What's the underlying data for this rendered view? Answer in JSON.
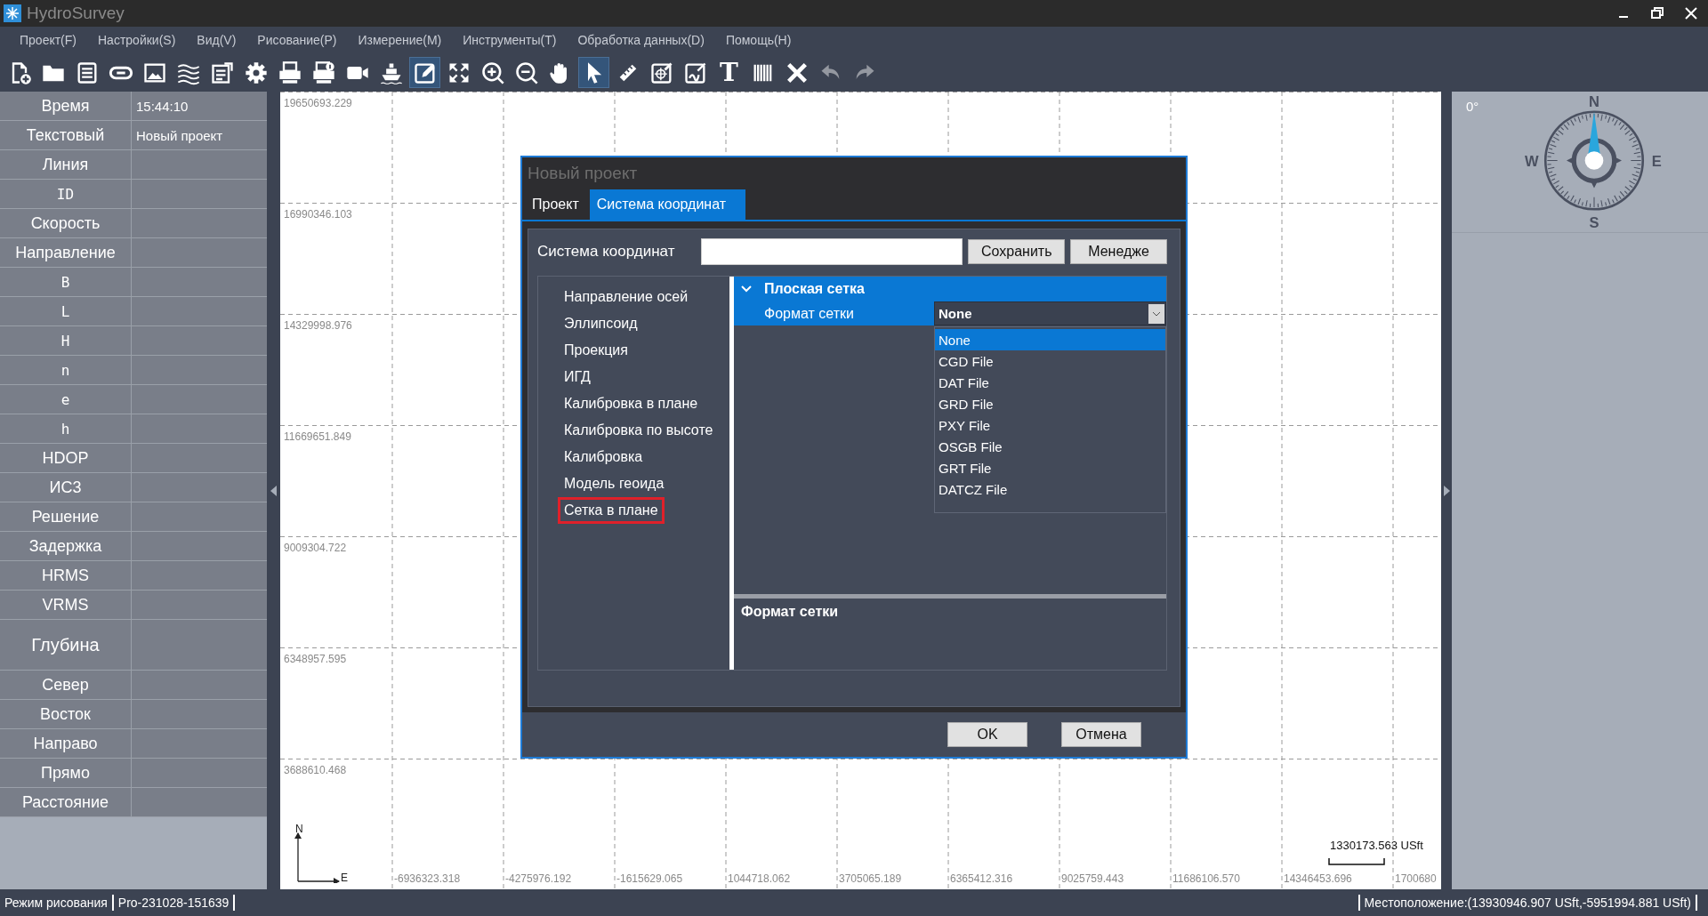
{
  "window": {
    "title": "HydroSurvey"
  },
  "menu": [
    "Проект(F)",
    "Настройки(S)",
    "Вид(V)",
    "Рисование(P)",
    "Измерение(M)",
    "Инструменты(T)",
    "Обработка данных(D)",
    "Помощь(H)"
  ],
  "toolbar": [
    {
      "selected": false,
      "disabled": false
    },
    {
      "selected": false,
      "disabled": false
    },
    {
      "selected": false,
      "disabled": false
    },
    {
      "selected": false,
      "disabled": false
    },
    {
      "selected": false,
      "disabled": false
    },
    {
      "selected": false,
      "disabled": false
    },
    {
      "selected": false,
      "disabled": false
    },
    {
      "selected": false,
      "disabled": false
    },
    {
      "selected": false,
      "disabled": false
    },
    {
      "selected": false,
      "disabled": false
    },
    {
      "selected": false,
      "disabled": false
    },
    {
      "selected": false,
      "disabled": false
    },
    {
      "selected": true,
      "disabled": false
    },
    {
      "selected": false,
      "disabled": false
    },
    {
      "selected": false,
      "disabled": false
    },
    {
      "selected": false,
      "disabled": false
    },
    {
      "selected": false,
      "disabled": false
    },
    {
      "selected": true,
      "disabled": false
    },
    {
      "selected": false,
      "disabled": false
    },
    {
      "selected": false,
      "disabled": false
    },
    {
      "selected": false,
      "disabled": false
    },
    {
      "glyph": "T",
      "selected": false,
      "disabled": false
    },
    {
      "selected": false,
      "disabled": false
    },
    {
      "selected": false,
      "disabled": false
    },
    {
      "selected": false,
      "disabled": true
    },
    {
      "selected": false,
      "disabled": true
    }
  ],
  "info_table": [
    {
      "label": "Время",
      "value": "15:44:10",
      "kind": "text"
    },
    {
      "label": "Текстовый",
      "value": "Новый проект",
      "kind": "text"
    },
    {
      "label": "Линия",
      "kind": "text"
    },
    {
      "label": "ID",
      "kind": "symbol"
    },
    {
      "label": "Скорость",
      "kind": "text"
    },
    {
      "label": "Направление",
      "kind": "text"
    },
    {
      "label": "B",
      "kind": "symbol"
    },
    {
      "label": "L",
      "kind": "symbol"
    },
    {
      "label": "H",
      "kind": "symbol"
    },
    {
      "label": "n",
      "kind": "symbol"
    },
    {
      "label": "e",
      "kind": "symbol"
    },
    {
      "label": "h",
      "kind": "symbol"
    },
    {
      "label": "HDOP",
      "kind": "text"
    },
    {
      "label": "ИС3",
      "kind": "text"
    },
    {
      "label": "Решение",
      "kind": "text"
    },
    {
      "label": "Задержка",
      "kind": "text"
    },
    {
      "label": "HRMS",
      "kind": "text"
    },
    {
      "label": "VRMS",
      "kind": "text"
    },
    {
      "label": "Глубина",
      "kind": "tall"
    },
    {
      "label": "Север",
      "kind": "text"
    },
    {
      "label": "Восток",
      "kind": "text"
    },
    {
      "label": "Направо",
      "kind": "text"
    },
    {
      "label": "Прямо",
      "kind": "text"
    },
    {
      "label": "Расстояние",
      "kind": "text"
    }
  ],
  "map": {
    "y_labels": [
      "19650693.229",
      "16990346.103",
      "14329998.976",
      "11669651.849",
      "9009304.722",
      "6348957.595",
      "3688610.468"
    ],
    "x_labels": [
      "-6936323.318",
      "-4275976.192",
      "-1615629.065",
      "1044718.062",
      "3705065.189",
      "6365412.316",
      "9025759.443",
      "11686106.570",
      "14346453.696",
      "1700680"
    ],
    "north_label": "N",
    "east_label": "E",
    "scale": "1330173.563 USft"
  },
  "compass": {
    "heading": "0°",
    "north": "N",
    "east": "E",
    "south": "S",
    "west": "W"
  },
  "dialog": {
    "title": "Новый проект",
    "tabs": [
      {
        "label": "Проект",
        "selected": false
      },
      {
        "label": "Система координат",
        "selected": true
      }
    ],
    "coord_label": "Система координат",
    "coord_buttons": [
      "Сохранить",
      "Менедже"
    ],
    "nav_items": [
      {
        "label": "Направление осей",
        "selected": false
      },
      {
        "label": "Эллипсоид",
        "selected": false
      },
      {
        "label": "Проекция",
        "selected": false
      },
      {
        "label": "ИГД",
        "selected": false
      },
      {
        "label": "Калибровка в плане",
        "selected": false
      },
      {
        "label": "Калибровка по высоте",
        "selected": false
      },
      {
        "label": "Калибровка",
        "selected": false
      },
      {
        "label": "Модель геоида",
        "selected": false
      },
      {
        "label": "Сетка в плане",
        "selected": true
      }
    ],
    "property_grid": {
      "category": "Плоская сетка",
      "expanded": true,
      "property": "Формат сетки",
      "property_selected": true,
      "value": "None",
      "options": [
        {
          "label": "None",
          "selected": true
        },
        {
          "label": "CGD File",
          "selected": false
        },
        {
          "label": "DAT File",
          "selected": false
        },
        {
          "label": "GRD File",
          "selected": false
        },
        {
          "label": "PXY File",
          "selected": false
        },
        {
          "label": "OSGB File",
          "selected": false
        },
        {
          "label": "GRT File",
          "selected": false
        },
        {
          "label": "DATCZ File",
          "selected": false
        }
      ]
    },
    "description": "Формат сетки",
    "buttons": [
      "OK",
      "Отмена"
    ]
  },
  "status_bar": {
    "mode": "Режим рисования",
    "version": "Pro-231028-151639",
    "location": "Местоположение:(13930946.907 USft,-5951994.881 USft)"
  }
}
